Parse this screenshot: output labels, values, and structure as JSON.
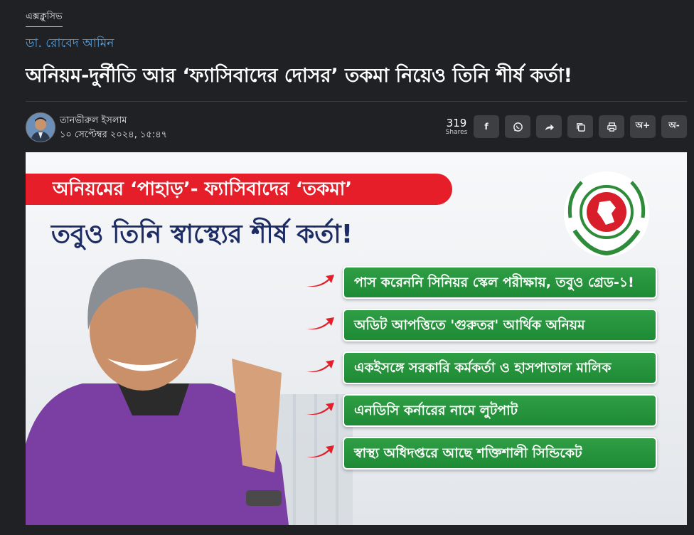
{
  "article": {
    "category": "এক্সক্লুসিভ",
    "reporter": "ডা. রোবেদ আমিন",
    "headline": "অনিয়ম-দুর্নীতি আর ‘ফ্যাসিবাদের দোসর’ তকমা নিয়েও তিনি শীর্ষ কর্তা!"
  },
  "byline": {
    "author": "তানভীরুল ইসলাম",
    "published": "১০ সেপ্টেম্বর ২০২৪, ১৫:৪৭"
  },
  "share": {
    "count": "319",
    "label": "Shares",
    "buttons": [
      {
        "icon": "facebook-icon",
        "text": "f"
      },
      {
        "icon": "whatsapp-icon",
        "text": ""
      },
      {
        "icon": "share-icon",
        "text": ""
      },
      {
        "icon": "copy-icon",
        "text": ""
      },
      {
        "icon": "print-icon",
        "text": ""
      },
      {
        "icon": "font-increase-icon",
        "text": "অ+"
      },
      {
        "icon": "font-decrease-icon",
        "text": "অ-"
      }
    ]
  },
  "hero": {
    "ribbon": "অনিয়মের ‘পাহাড়’- ফ্যাসিবাদের ‘তকমা’",
    "subheading": "তবুও তিনি স্বাস্থ্যের শীর্ষ কর্তা!",
    "points": [
      "পাস করেননি সিনিয়র স্কেল পরীক্ষায়, তবুও গ্রেড-১!",
      "অডিট আপত্তিতে 'গুরুতর' আর্থিক অনিয়ম",
      "একইসঙ্গে সরকারি কর্মকর্তা ও হাসপাতাল মালিক",
      "এনডিসি কর্নারের নামে লুটপাট",
      "স্বাস্থ্য অধিদপ্তরে আছে শক্তিশালী সিন্ডিকেট"
    ],
    "colors": {
      "ribbon": "#e51e2a",
      "subheading": "#1d2d64",
      "point": "#1e8a35"
    }
  }
}
